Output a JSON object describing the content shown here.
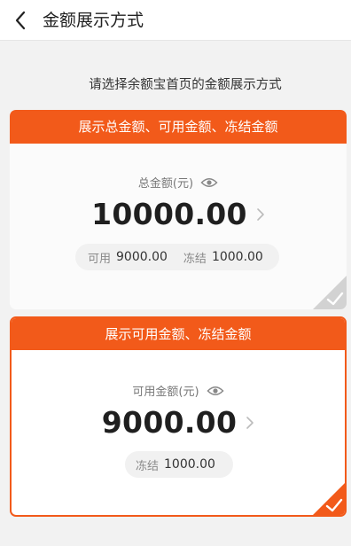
{
  "header": {
    "title": "金额展示方式",
    "back_icon": "chevron-left-icon"
  },
  "subtitle": "请选择余额宝首页的金额展示方式",
  "colors": {
    "accent": "#f25a1a",
    "check_unselected": "#d2d2d2"
  },
  "options": [
    {
      "title": "展示总金额、可用金额、冻结金额",
      "amount_label": "总金额(元)",
      "amount": "10000.00",
      "details": [
        {
          "label": "可用",
          "value": "9000.00"
        },
        {
          "label": "冻结",
          "value": "1000.00"
        }
      ],
      "selected": false
    },
    {
      "title": "展示可用金额、冻结金额",
      "amount_label": "可用金额(元)",
      "amount": "9000.00",
      "details": [
        {
          "label": "冻结",
          "value": "1000.00"
        }
      ],
      "selected": true
    }
  ]
}
